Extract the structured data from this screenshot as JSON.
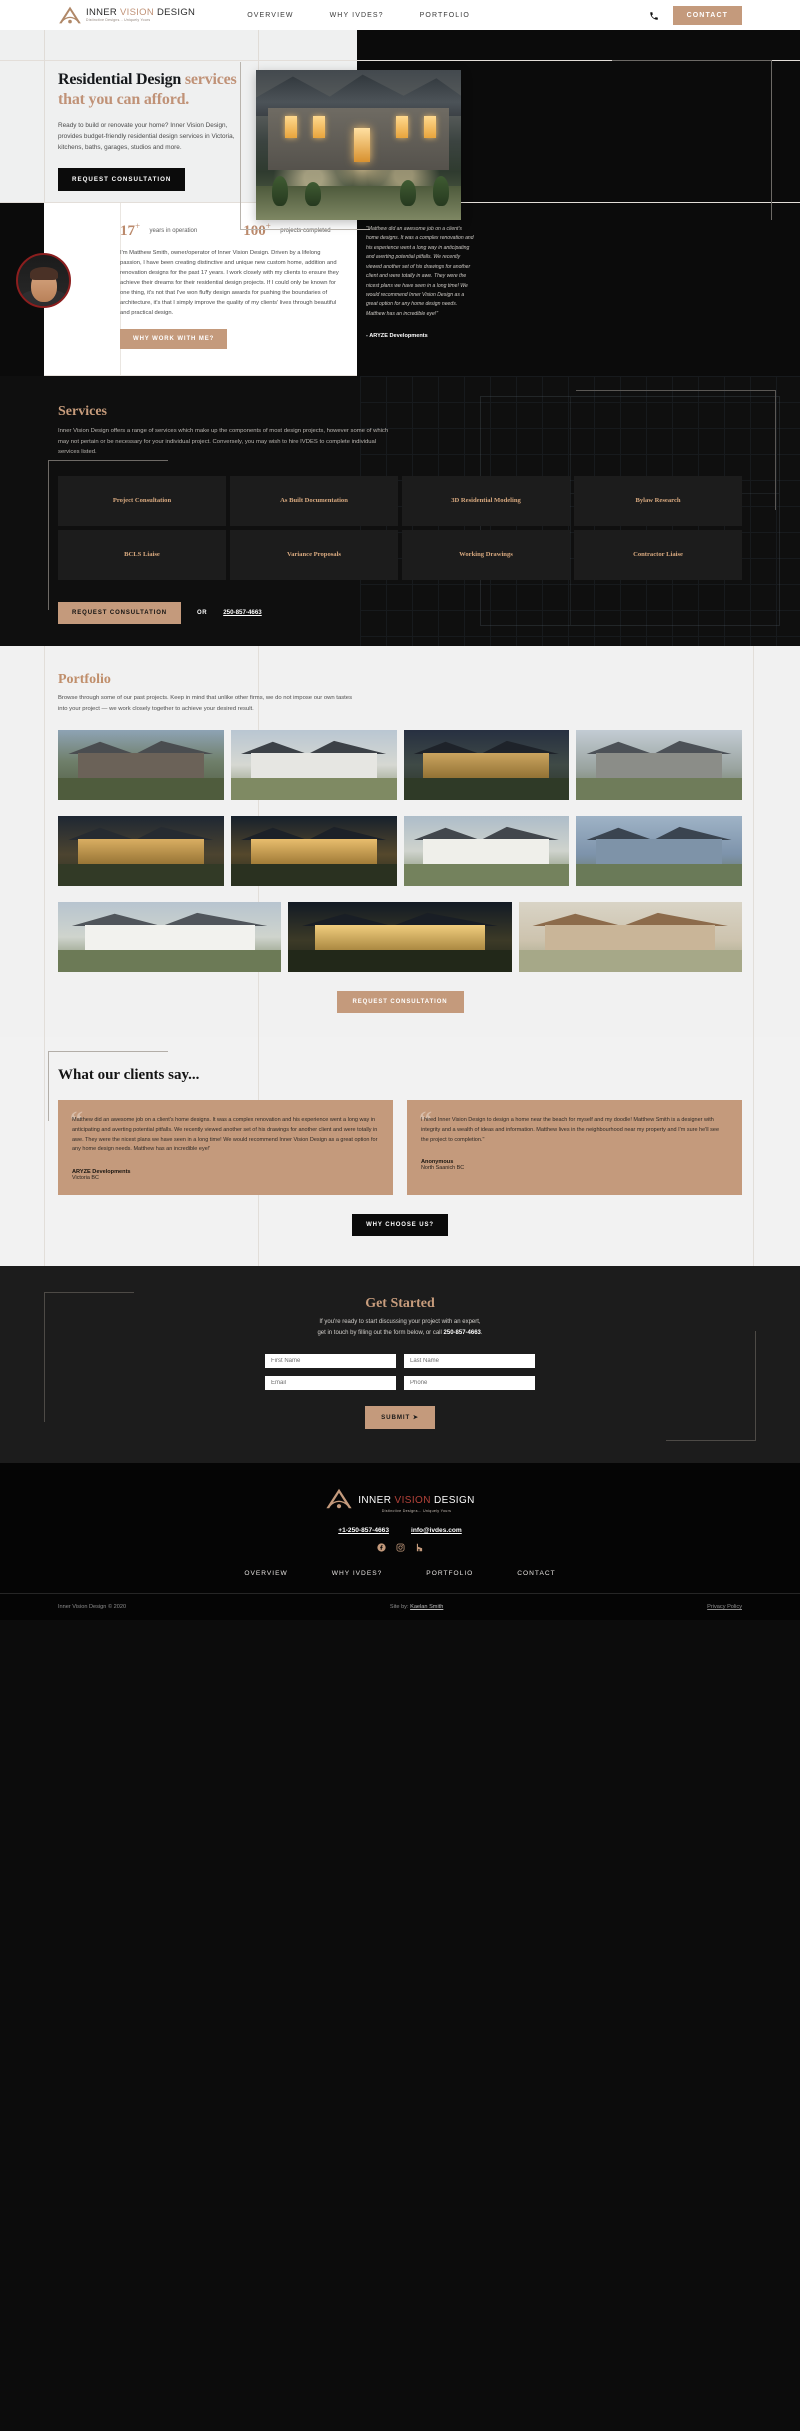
{
  "brand": {
    "name_part1": "INNER ",
    "name_vision": "VISION",
    "name_part3": " DESIGN",
    "tagline": "Distinctive Designs... Uniquely Yours",
    "accent_color": "#c49a7c",
    "dark_color": "#0b0b0b"
  },
  "nav": {
    "links": [
      {
        "label": "OVERVIEW"
      },
      {
        "label": "WHY IVDES?"
      },
      {
        "label": "PORTFOLIO"
      }
    ],
    "phone_icon": "phone-icon",
    "contact_button": "CONTACT"
  },
  "hero": {
    "title_black": "Residential Design ",
    "title_accent_1": "services",
    "title_accent_2": "that you can afford.",
    "paragraph": "Ready to build or renovate your home? Inner Vision Design, provides budget-friendly residential design services in Victoria, kitchens, baths, garages, studios and more.",
    "cta": "REQUEST CONSULTATION"
  },
  "about": {
    "stats": [
      {
        "number": "17",
        "plus": "+",
        "label": "years in operation"
      },
      {
        "number": "100",
        "plus": "+",
        "label": "projects completed"
      }
    ],
    "paragraph": "I'm Matthew Smith, owner/operator of Inner Vision Design. Driven by a lifelong passion, I have been creating distinctive and unique new custom home, addition and renovation designs for the past 17 years. I work closely with my clients to ensure they achieve their dreams for their residential design projects. If I could only be known for one thing, it's not that I've won fluffy design awards for pushing the boundaries of architecture, it's that I simply improve the quality of my clients' lives through beautiful and practical design.",
    "cta": "WHY WORK WITH ME?",
    "quote": "\"Matthew did an awesome job on a client's home designs. It was a complex renovation and his experience went a long way in anticipating and averting potential pitfalls. We recently viewed another set of his drawings for another client and were totally in awe. They were the nicest plans we have seen in a long time! We would recommend Inner Vision Design as a great option for any home design needs. Matthew has an incredible eye!\"",
    "quote_author": "- ARYZE Developments"
  },
  "services": {
    "heading": "Services",
    "paragraph": "Inner Vision Design offers a range of services which make up the components of most design projects, however some of which may not pertain or be necessary for your individual project. Conversely, you may wish to hire IVDES to complete individual services listed.",
    "items": [
      {
        "label": "Project Consultation"
      },
      {
        "label": "As Built Documentation"
      },
      {
        "label": "3D Residential Modeling"
      },
      {
        "label": "Bylaw Research"
      },
      {
        "label": "BCLS Liaise"
      },
      {
        "label": "Variance Proposals"
      },
      {
        "label": "Working Drawings"
      },
      {
        "label": "Contractor Liaise"
      }
    ],
    "cta": "REQUEST CONSULTATION",
    "or": "OR",
    "phone": "250-857-4663"
  },
  "portfolio": {
    "heading": "Portfolio",
    "paragraph": "Browse through some of our past projects. Keep in mind that unlike other firms, we do not impose our own tastes into your project — we work closely together to achieve your desired result.",
    "cta": "REQUEST CONSULTATION",
    "thumbnails": [
      {
        "alt": "stone-and-timber-home-thumbnail"
      },
      {
        "alt": "white-modern-home-thumbnail"
      },
      {
        "alt": "warm-lit-evening-home-thumbnail"
      },
      {
        "alt": "grey-craftsman-home-thumbnail"
      },
      {
        "alt": "lit-estate-home-thumbnail"
      },
      {
        "alt": "evening-glass-home-thumbnail"
      },
      {
        "alt": "white-heritage-home-thumbnail"
      },
      {
        "alt": "blue-victorian-home-thumbnail"
      },
      {
        "alt": "white-farmhouse-thumbnail"
      },
      {
        "alt": "modern-night-home-thumbnail"
      },
      {
        "alt": "3d-render-home-thumbnail"
      }
    ]
  },
  "clients": {
    "heading": "What our clients say...",
    "testimonials": [
      {
        "text": "Matthew did an awesome job on a client's home designs. It was a complex renovation and his experience went a long way in anticipating and averting potential pitfalls. We recently viewed another set of his drawings for another client and were totally in awe. They were the nicest plans we have seen in a long time! We would recommend Inner Vision Design as a great option for any home design needs. Matthew has an incredible eye!'",
        "name": "ARYZE Developments",
        "location": "Victoria BC"
      },
      {
        "text": "I hired Inner Vision Design to design a home near the beach for myself and my doodle! Matthew Smith is a designer with integrity and a wealth of ideas and information. Matthew lives in the neighbourhood near my property and I'm sure he'll see the project to completion.\"",
        "name": "Anonymous",
        "location": "North Saanich BC"
      }
    ],
    "cta": "WHY CHOOSE US?"
  },
  "started": {
    "heading": "Get Started",
    "paragraph_1": "If you're ready to start discussing your project with an expert,",
    "paragraph_2a": "get in touch by filling out the form below, or call ",
    "paragraph_phone": "250-857-4663",
    "paragraph_2b": ".",
    "fields": [
      {
        "placeholder": "First Name",
        "value": ""
      },
      {
        "placeholder": "Last Name",
        "value": ""
      },
      {
        "placeholder": "Email",
        "value": ""
      },
      {
        "placeholder": "Phone",
        "value": ""
      }
    ],
    "submit": "SUBMIT  ➤"
  },
  "footer": {
    "phone": "+1-250-857-4663",
    "email": "info@ivdes.com",
    "social": [
      {
        "name": "facebook-icon",
        "glyph": "f"
      },
      {
        "name": "instagram-icon",
        "glyph": "◉"
      },
      {
        "name": "houzz-icon",
        "glyph": "h"
      }
    ],
    "nav": [
      {
        "label": "OVERVIEW"
      },
      {
        "label": "WHY IVDES?"
      },
      {
        "label": "PORTFOLIO"
      },
      {
        "label": "CONTACT"
      }
    ],
    "copyright": "Inner Vision Design © 2020",
    "site_by_prefix": "Site by: ",
    "site_by_name": "Kaelan Smith",
    "privacy": "Privacy Policy"
  }
}
